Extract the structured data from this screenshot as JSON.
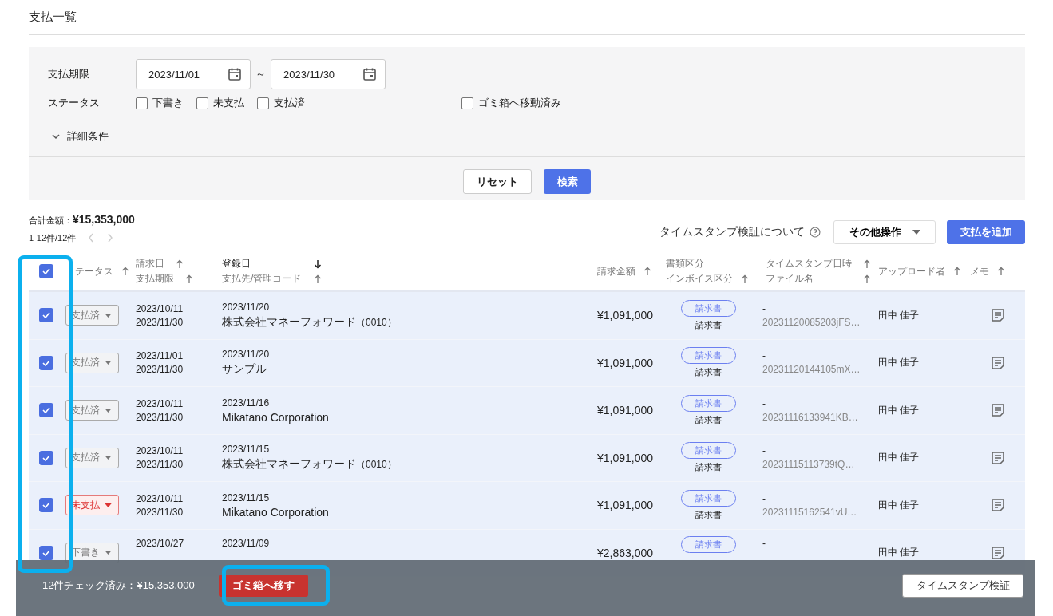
{
  "page_title": "支払一覧",
  "filters": {
    "due_label": "支払期限",
    "date_from": "2023/11/01",
    "tilde": "～",
    "date_to": "2023/11/30",
    "status_label": "ステータス",
    "status_options": [
      {
        "label": "下書き",
        "checked": false
      },
      {
        "label": "未支払",
        "checked": false
      },
      {
        "label": "支払済",
        "checked": false
      },
      {
        "label": "ゴミ箱へ移動済み",
        "checked": false
      }
    ],
    "detail_toggle": {
      "label": "詳細条件",
      "expanded": false
    },
    "reset_button": "リセット",
    "search_button": "検索"
  },
  "summary": {
    "total_label": "合計金額：",
    "total": "¥15,353,000",
    "range": "1-12件/12件"
  },
  "toolbar": {
    "help_link": "タイムスタンプ検証について",
    "more_button": "その他操作",
    "add_button": "支払を追加"
  },
  "table": {
    "select_all": true,
    "columns": [
      {
        "lines": [
          {
            "text": "テータス",
            "sortable": true,
            "sorted": false
          }
        ]
      },
      {
        "lines": [
          {
            "text": "請求日",
            "sortable": true,
            "sorted": false
          },
          {
            "text": "支払期限",
            "sortable": true,
            "sorted": false
          }
        ]
      },
      {
        "lines": [
          {
            "text": "登録日",
            "sortable": true,
            "sorted": true
          },
          {
            "text": "支払先/管理コード",
            "sortable": true,
            "sorted": false
          }
        ]
      },
      {
        "lines": [
          {
            "text": "請求金額",
            "sortable": true,
            "sorted": false
          }
        ]
      },
      {
        "lines": [
          {
            "text": "書類区分",
            "sortable": false,
            "sorted": false
          },
          {
            "text": "インボイス区分",
            "sortable": true,
            "sorted": false
          }
        ]
      },
      {
        "lines": [
          {
            "text": "タイムスタンプ日時",
            "sortable": true,
            "sorted": false
          },
          {
            "text": "ファイル名",
            "sortable": true,
            "sorted": false
          }
        ]
      },
      {
        "lines": [
          {
            "text": "アップロード者",
            "sortable": true,
            "sorted": false
          }
        ]
      },
      {
        "lines": [
          {
            "text": "メモ",
            "sortable": true,
            "sorted": false
          }
        ]
      }
    ],
    "rows": [
      {
        "checked": true,
        "status": {
          "label": "支払済",
          "kind": "paid"
        },
        "invoice_date": "2023/10/11",
        "due_date": "2023/11/30",
        "registered": "2023/11/20",
        "payee": "株式会社マネーフォワード",
        "code": "（0010）",
        "amount": "¥1,091,000",
        "doc_type": "請求書",
        "invoice_type": "請求書",
        "timestamp": "-",
        "file": "20231120085203jFS…",
        "uploader": "田中 佳子"
      },
      {
        "checked": true,
        "status": {
          "label": "支払済",
          "kind": "paid"
        },
        "invoice_date": "2023/11/01",
        "due_date": "2023/11/30",
        "registered": "2023/11/20",
        "payee": "サンプル",
        "amount": "¥1,091,000",
        "doc_type": "請求書",
        "invoice_type": "請求書",
        "timestamp": "-",
        "file": "20231120144105mX…",
        "uploader": "田中 佳子"
      },
      {
        "checked": true,
        "status": {
          "label": "支払済",
          "kind": "paid"
        },
        "invoice_date": "2023/10/11",
        "due_date": "2023/11/30",
        "registered": "2023/11/16",
        "payee": "Mikatano Corporation",
        "amount": "¥1,091,000",
        "doc_type": "請求書",
        "invoice_type": "請求書",
        "timestamp": "-",
        "file": "20231116133941KB…",
        "uploader": "田中 佳子"
      },
      {
        "checked": true,
        "status": {
          "label": "支払済",
          "kind": "paid"
        },
        "invoice_date": "2023/10/11",
        "due_date": "2023/11/30",
        "registered": "2023/11/15",
        "payee": "株式会社マネーフォワード",
        "code": "（0010）",
        "amount": "¥1,091,000",
        "doc_type": "請求書",
        "invoice_type": "請求書",
        "timestamp": "-",
        "file": "20231115113739tQ…",
        "uploader": "田中 佳子"
      },
      {
        "checked": true,
        "status": {
          "label": "未支払",
          "kind": "unpaid"
        },
        "invoice_date": "2023/10/11",
        "due_date": "2023/11/30",
        "registered": "2023/11/15",
        "payee": "Mikatano Corporation",
        "amount": "¥1,091,000",
        "doc_type": "請求書",
        "invoice_type": "請求書",
        "timestamp": "-",
        "file": "20231115162541vU…",
        "uploader": "田中 佳子"
      },
      {
        "checked": true,
        "status": {
          "label": "下書き",
          "kind": "draft"
        },
        "invoice_date": "2023/10/27",
        "registered": "2023/11/09",
        "amount": "¥2,863,000",
        "doc_type": "請求書",
        "timestamp": "-",
        "uploader": "田中 佳子"
      }
    ]
  },
  "bulk_bar": {
    "count": "12件チェック済み：¥15,353,000",
    "trash_button": "ゴミ箱へ移す",
    "verify_button": "タイムスタンプ検証"
  }
}
